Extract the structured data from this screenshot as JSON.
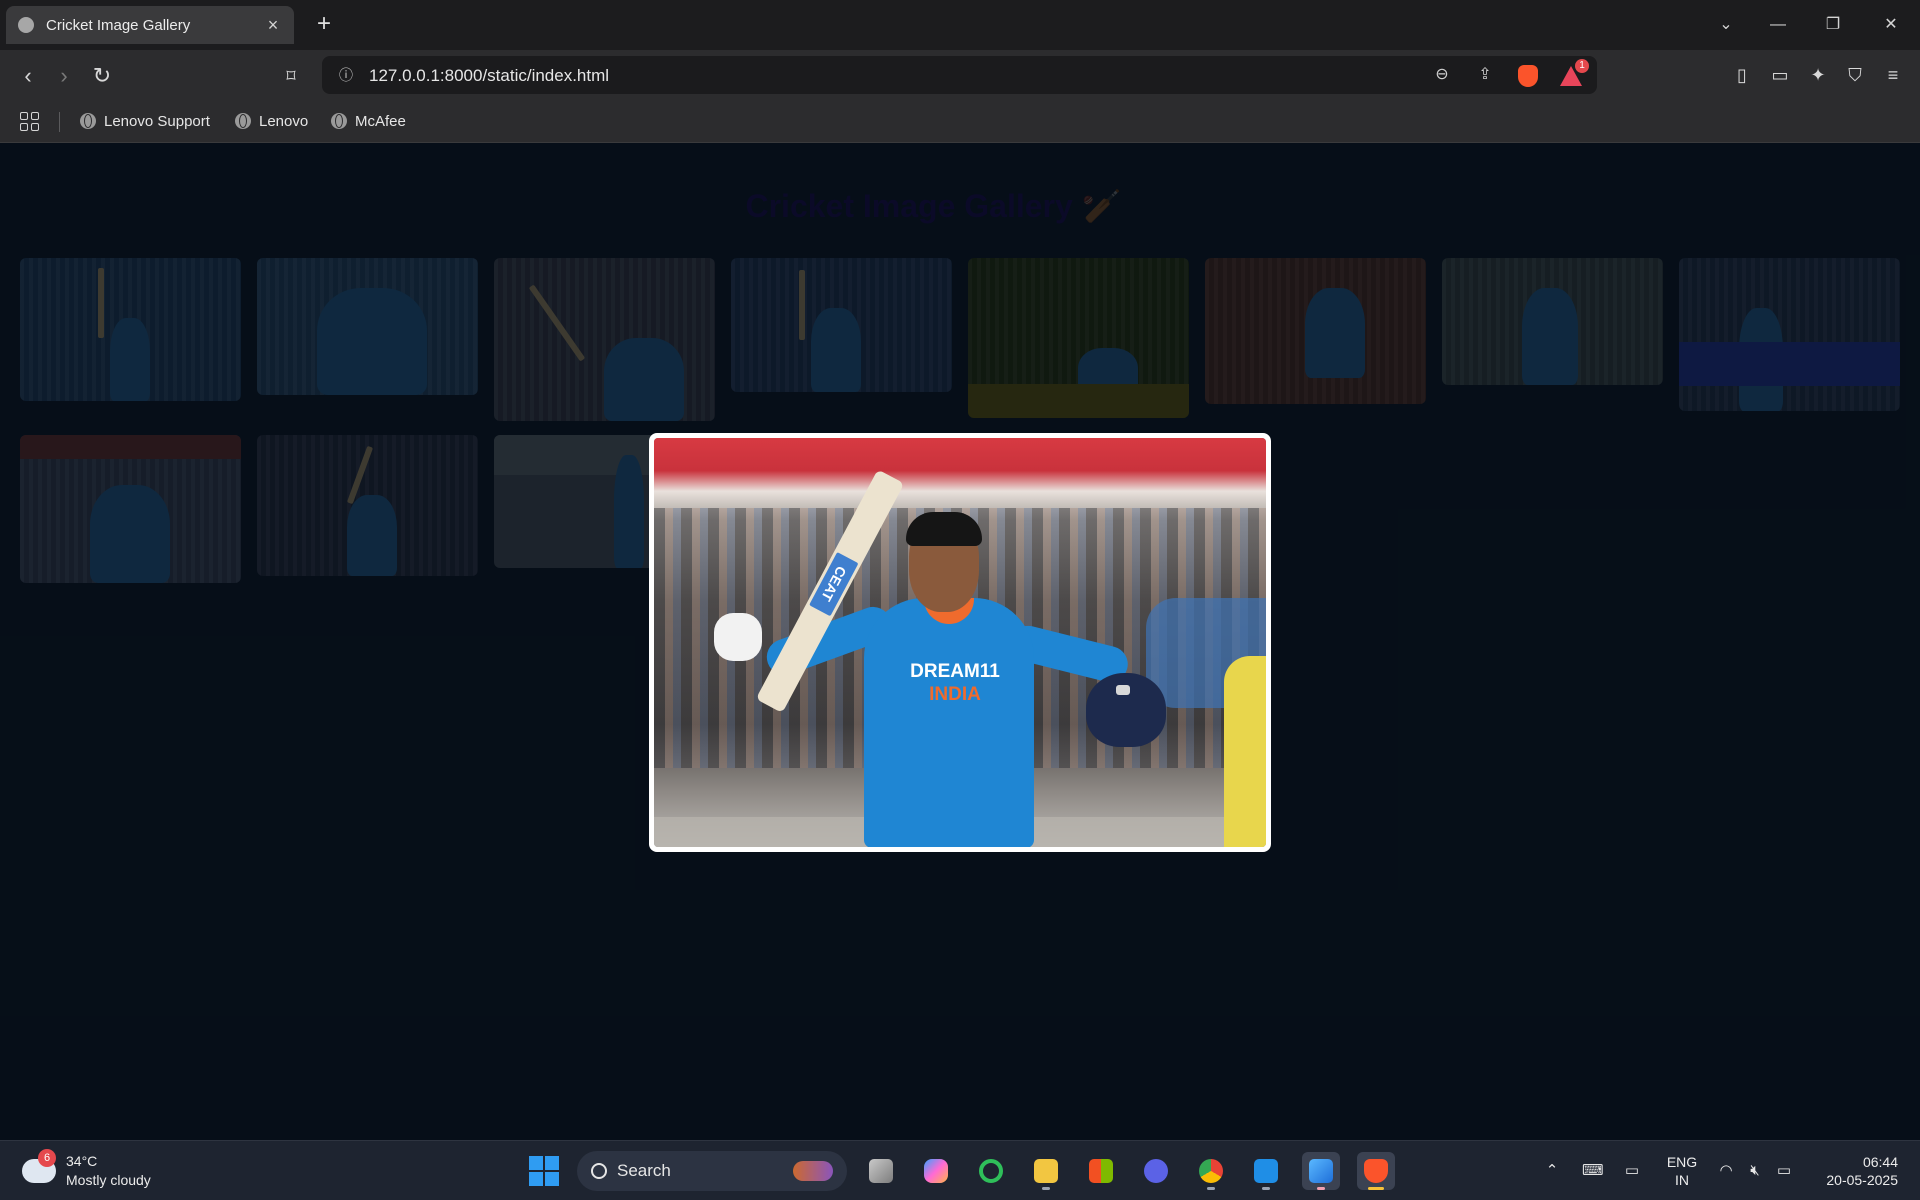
{
  "browser": {
    "tab_title": "Cricket Image Gallery",
    "url": "127.0.0.1:8000/static/index.html",
    "shields_count": "1",
    "bookmarks": [
      {
        "label": "Lenovo Support"
      },
      {
        "label": "Lenovo"
      },
      {
        "label": "McAfee"
      }
    ]
  },
  "page": {
    "title": "Cricket Image Gallery",
    "title_emoji": "🏏",
    "title_color": "#15134a",
    "background": "#0b1b2c",
    "gallery_count": 11,
    "lightbox_open": true,
    "lightbox_image": {
      "jersey_line1": "DREAM11",
      "jersey_line2": "INDIA",
      "bat_brand": "CEAT"
    }
  },
  "taskbar": {
    "weather": {
      "temp": "34°C",
      "condition": "Mostly cloudy",
      "badge": "6"
    },
    "search_label": "Search",
    "lang_line1": "ENG",
    "lang_line2": "IN",
    "time": "06:44",
    "date": "20-05-2025",
    "apps": [
      "task-view",
      "copilot",
      "ring-app",
      "file-explorer",
      "microsoft-store",
      "arc-app",
      "chrome",
      "vscode",
      "photos",
      "brave"
    ]
  },
  "colors": {
    "accent_blue": "#1f86d3",
    "jersey_orange": "#ef6b2d",
    "brave_orange": "#fb542b"
  }
}
